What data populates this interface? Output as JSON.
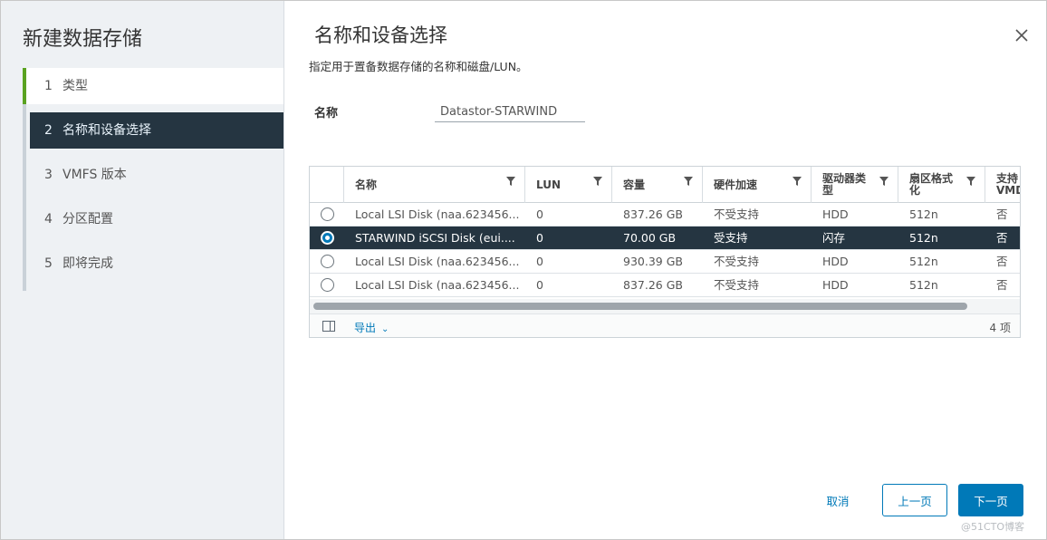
{
  "wizard": {
    "title": "新建数据存储",
    "steps": [
      {
        "num": "1",
        "label": "类型",
        "state": "done"
      },
      {
        "num": "2",
        "label": "名称和设备选择",
        "state": "active"
      },
      {
        "num": "3",
        "label": "VMFS 版本",
        "state": "pending"
      },
      {
        "num": "4",
        "label": "分区配置",
        "state": "pending"
      },
      {
        "num": "5",
        "label": "即将完成",
        "state": "pending"
      }
    ]
  },
  "page": {
    "title": "名称和设备选择",
    "subtitle": "指定用于置备数据存储的名称和磁盘/LUN。",
    "name_label": "名称",
    "name_value": "Datastor-STARWIND"
  },
  "grid": {
    "columns": [
      "名称",
      "LUN",
      "容量",
      "硬件加速",
      "驱动器类型",
      "扇区格式化",
      "支持VMD"
    ],
    "rows": [
      {
        "name": "Local LSI Disk (naa.623456...",
        "lun": "0",
        "capacity": "837.26 GB",
        "hw_accel": "不受支持",
        "drive_type": "HDD",
        "sector": "512n",
        "vmd": "否",
        "selected": false
      },
      {
        "name": "STARWIND iSCSI Disk (eui....",
        "lun": "0",
        "capacity": "70.00 GB",
        "hw_accel": "受支持",
        "drive_type": "闪存",
        "sector": "512n",
        "vmd": "否",
        "selected": true
      },
      {
        "name": "Local LSI Disk (naa.623456...",
        "lun": "0",
        "capacity": "930.39 GB",
        "hw_accel": "不受支持",
        "drive_type": "HDD",
        "sector": "512n",
        "vmd": "否",
        "selected": false
      },
      {
        "name": "Local LSI Disk (naa.623456...",
        "lun": "0",
        "capacity": "837.26 GB",
        "hw_accel": "不受支持",
        "drive_type": "HDD",
        "sector": "512n",
        "vmd": "否",
        "selected": false
      }
    ],
    "export_label": "导出",
    "count_label": "4 项"
  },
  "buttons": {
    "cancel": "取消",
    "back": "上一页",
    "next": "下一页"
  },
  "watermark": "@51CTO博客",
  "colors": {
    "accent": "#0079b8",
    "selected_row": "#253541",
    "done_step": "#5aa220"
  }
}
